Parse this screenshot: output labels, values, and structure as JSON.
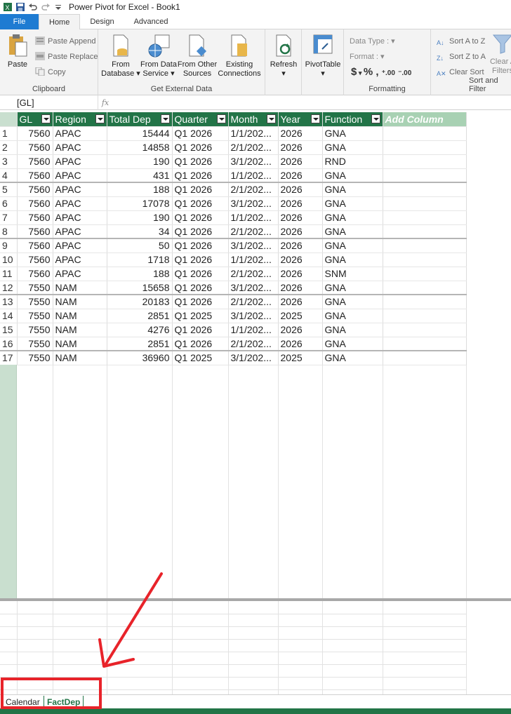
{
  "titlebar": {
    "title": "Power Pivot for Excel - Book1"
  },
  "ribbon_tabs": [
    "File",
    "Home",
    "Design",
    "Advanced"
  ],
  "ribbon": {
    "clipboard": {
      "label": "Clipboard",
      "paste": "Paste",
      "paste_append": "Paste Append",
      "paste_replace": "Paste Replace",
      "copy": "Copy"
    },
    "external": {
      "label": "Get External Data",
      "from_database_1": "From",
      "from_database_2": "Database",
      "from_data_service_1": "From Data",
      "from_data_service_2": "Service",
      "from_other_1": "From Other",
      "from_other_2": "Sources",
      "existing_1": "Existing",
      "existing_2": "Connections"
    },
    "refresh": "Refresh",
    "pivottable": "PivotTable",
    "formatting": {
      "label": "Formatting",
      "data_type": "Data Type :",
      "format": "Format :",
      "currency": "$",
      "percent": "%",
      "comma": ",",
      "inc_decimal": "⁺.00",
      "dec_decimal": "⁻.00"
    },
    "sort": {
      "label": "Sort and Filter",
      "sort_az": "Sort A to Z",
      "sort_za": "Sort Z to A",
      "clear_sort": "Clear Sort",
      "clear_all_1": "Clear A",
      "clear_all_2": "Filters"
    }
  },
  "formula_bar": {
    "name_box": "[GL]",
    "fx": "fx"
  },
  "table": {
    "columns": [
      "GL",
      "Region",
      "Total Dep",
      "Quarter",
      "Month",
      "Year",
      "Function"
    ],
    "add_column": "Add Column",
    "rows": [
      [
        "1",
        "7560",
        "APAC",
        "15444",
        "Q1 2026",
        "1/1/202...",
        "2026",
        "GNA"
      ],
      [
        "2",
        "7560",
        "APAC",
        "14858",
        "Q1 2026",
        "2/1/202...",
        "2026",
        "GNA"
      ],
      [
        "3",
        "7560",
        "APAC",
        "190",
        "Q1 2026",
        "3/1/202...",
        "2026",
        "RND"
      ],
      [
        "4",
        "7560",
        "APAC",
        "431",
        "Q1 2026",
        "1/1/202...",
        "2026",
        "GNA"
      ],
      [
        "5",
        "7560",
        "APAC",
        "188",
        "Q1 2026",
        "2/1/202...",
        "2026",
        "GNA"
      ],
      [
        "6",
        "7560",
        "APAC",
        "17078",
        "Q1 2026",
        "3/1/202...",
        "2026",
        "GNA"
      ],
      [
        "7",
        "7560",
        "APAC",
        "190",
        "Q1 2026",
        "1/1/202...",
        "2026",
        "GNA"
      ],
      [
        "8",
        "7560",
        "APAC",
        "34",
        "Q1 2026",
        "2/1/202...",
        "2026",
        "GNA"
      ],
      [
        "9",
        "7560",
        "APAC",
        "50",
        "Q1 2026",
        "3/1/202...",
        "2026",
        "GNA"
      ],
      [
        "10",
        "7560",
        "APAC",
        "1718",
        "Q1 2026",
        "1/1/202...",
        "2026",
        "GNA"
      ],
      [
        "11",
        "7560",
        "APAC",
        "188",
        "Q1 2026",
        "2/1/202...",
        "2026",
        "SNM"
      ],
      [
        "12",
        "7550",
        "NAM",
        "15658",
        "Q1 2026",
        "3/1/202...",
        "2026",
        "GNA"
      ],
      [
        "13",
        "7550",
        "NAM",
        "20183",
        "Q1 2026",
        "2/1/202...",
        "2026",
        "GNA"
      ],
      [
        "14",
        "7550",
        "NAM",
        "2851",
        "Q1 2025",
        "3/1/202...",
        "2025",
        "GNA"
      ],
      [
        "15",
        "7550",
        "NAM",
        "4276",
        "Q1 2026",
        "1/1/202...",
        "2026",
        "GNA"
      ],
      [
        "16",
        "7550",
        "NAM",
        "2851",
        "Q1 2026",
        "2/1/202...",
        "2026",
        "GNA"
      ],
      [
        "17",
        "7550",
        "NAM",
        "36960",
        "Q1 2025",
        "3/1/202...",
        "2025",
        "GNA"
      ]
    ]
  },
  "sheet_tabs": {
    "calendar": "Calendar",
    "factdep": "FactDep"
  },
  "colors": {
    "accent_green": "#227447",
    "file_blue": "#1e7bd2",
    "annotation_red": "#e8232a"
  }
}
